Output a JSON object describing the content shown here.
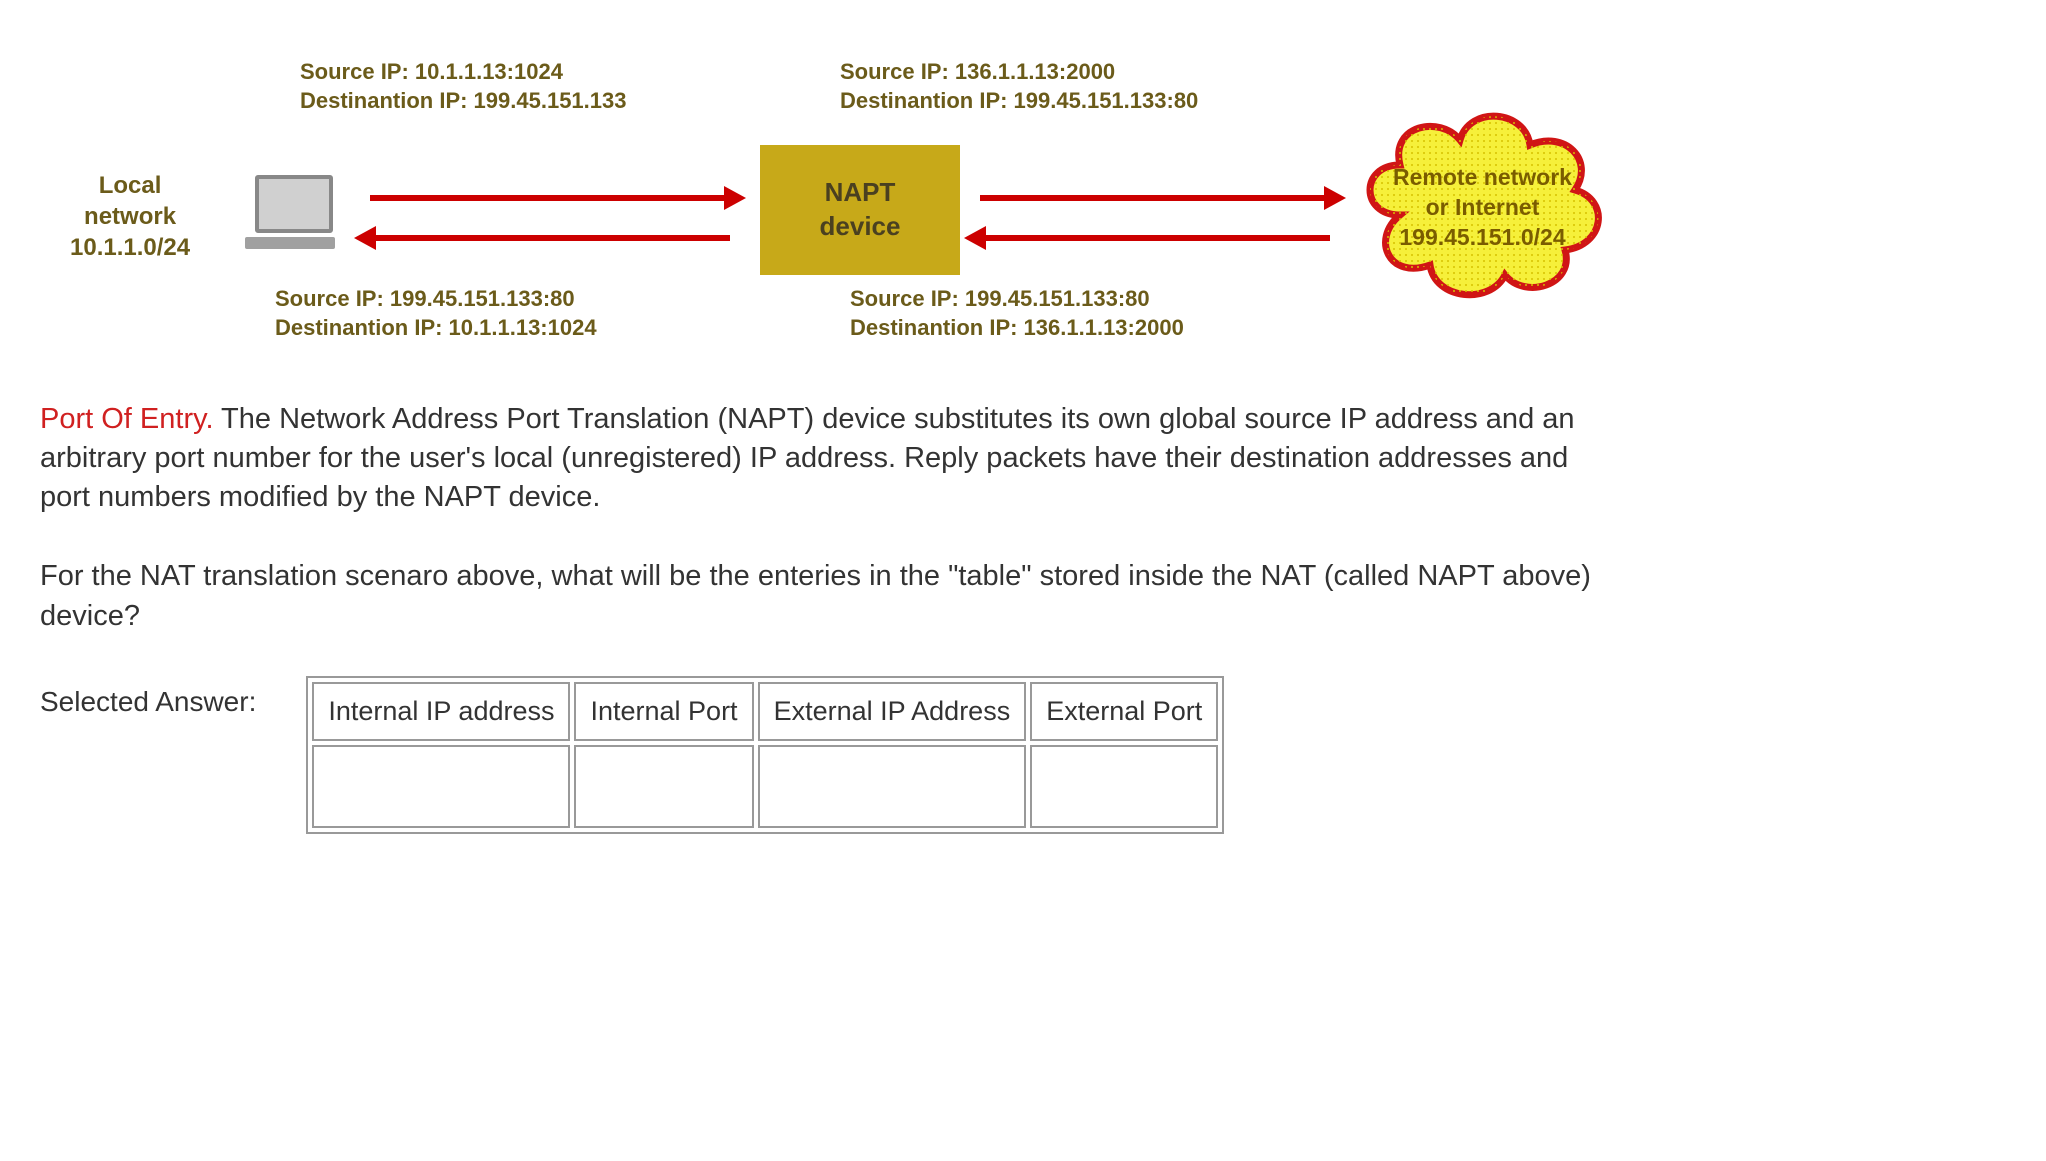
{
  "diagram": {
    "local_network": {
      "line1": "Local",
      "line2": "network",
      "line3": "10.1.1.0/24"
    },
    "napt_box": {
      "line1": "NAPT",
      "line2": "device"
    },
    "cloud": {
      "line1": "Remote network",
      "line2": "or Internet",
      "line3": "199.45.151.0/24"
    },
    "packets": {
      "top_left": {
        "src": "Source IP: 10.1.1.13:1024",
        "dst": "Destinantion IP: 199.45.151.133"
      },
      "top_right": {
        "src": "Source IP: 136.1.1.13:2000",
        "dst": "Destinantion IP: 199.45.151.133:80"
      },
      "bottom_left": {
        "src": "Source IP: 199.45.151.133:80",
        "dst": "Destinantion IP: 10.1.1.13:1024"
      },
      "bottom_right": {
        "src": "Source IP: 199.45.151.133:80",
        "dst": "Destinantion IP: 136.1.1.13:2000"
      }
    }
  },
  "body": {
    "port_of_entry_label": "Port Of Entry.",
    "port_of_entry_text": " The Network Address Port Translation (NAPT) device substitutes its own global source IP address and an arbitrary port number for the user's local (unregistered) IP address. Reply packets have their destination addresses and port numbers modified by the NAPT device.",
    "question": "For the NAT translation scenaro above, what will be the enteries in the \"table\" stored inside the NAT (called NAPT above) device?",
    "selected_answer_label": "Selected Answer:"
  },
  "table": {
    "headers": [
      "Internal IP address",
      "Internal Port",
      "External IP Address",
      "External Port"
    ],
    "row": [
      "",
      "",
      "",
      ""
    ]
  }
}
